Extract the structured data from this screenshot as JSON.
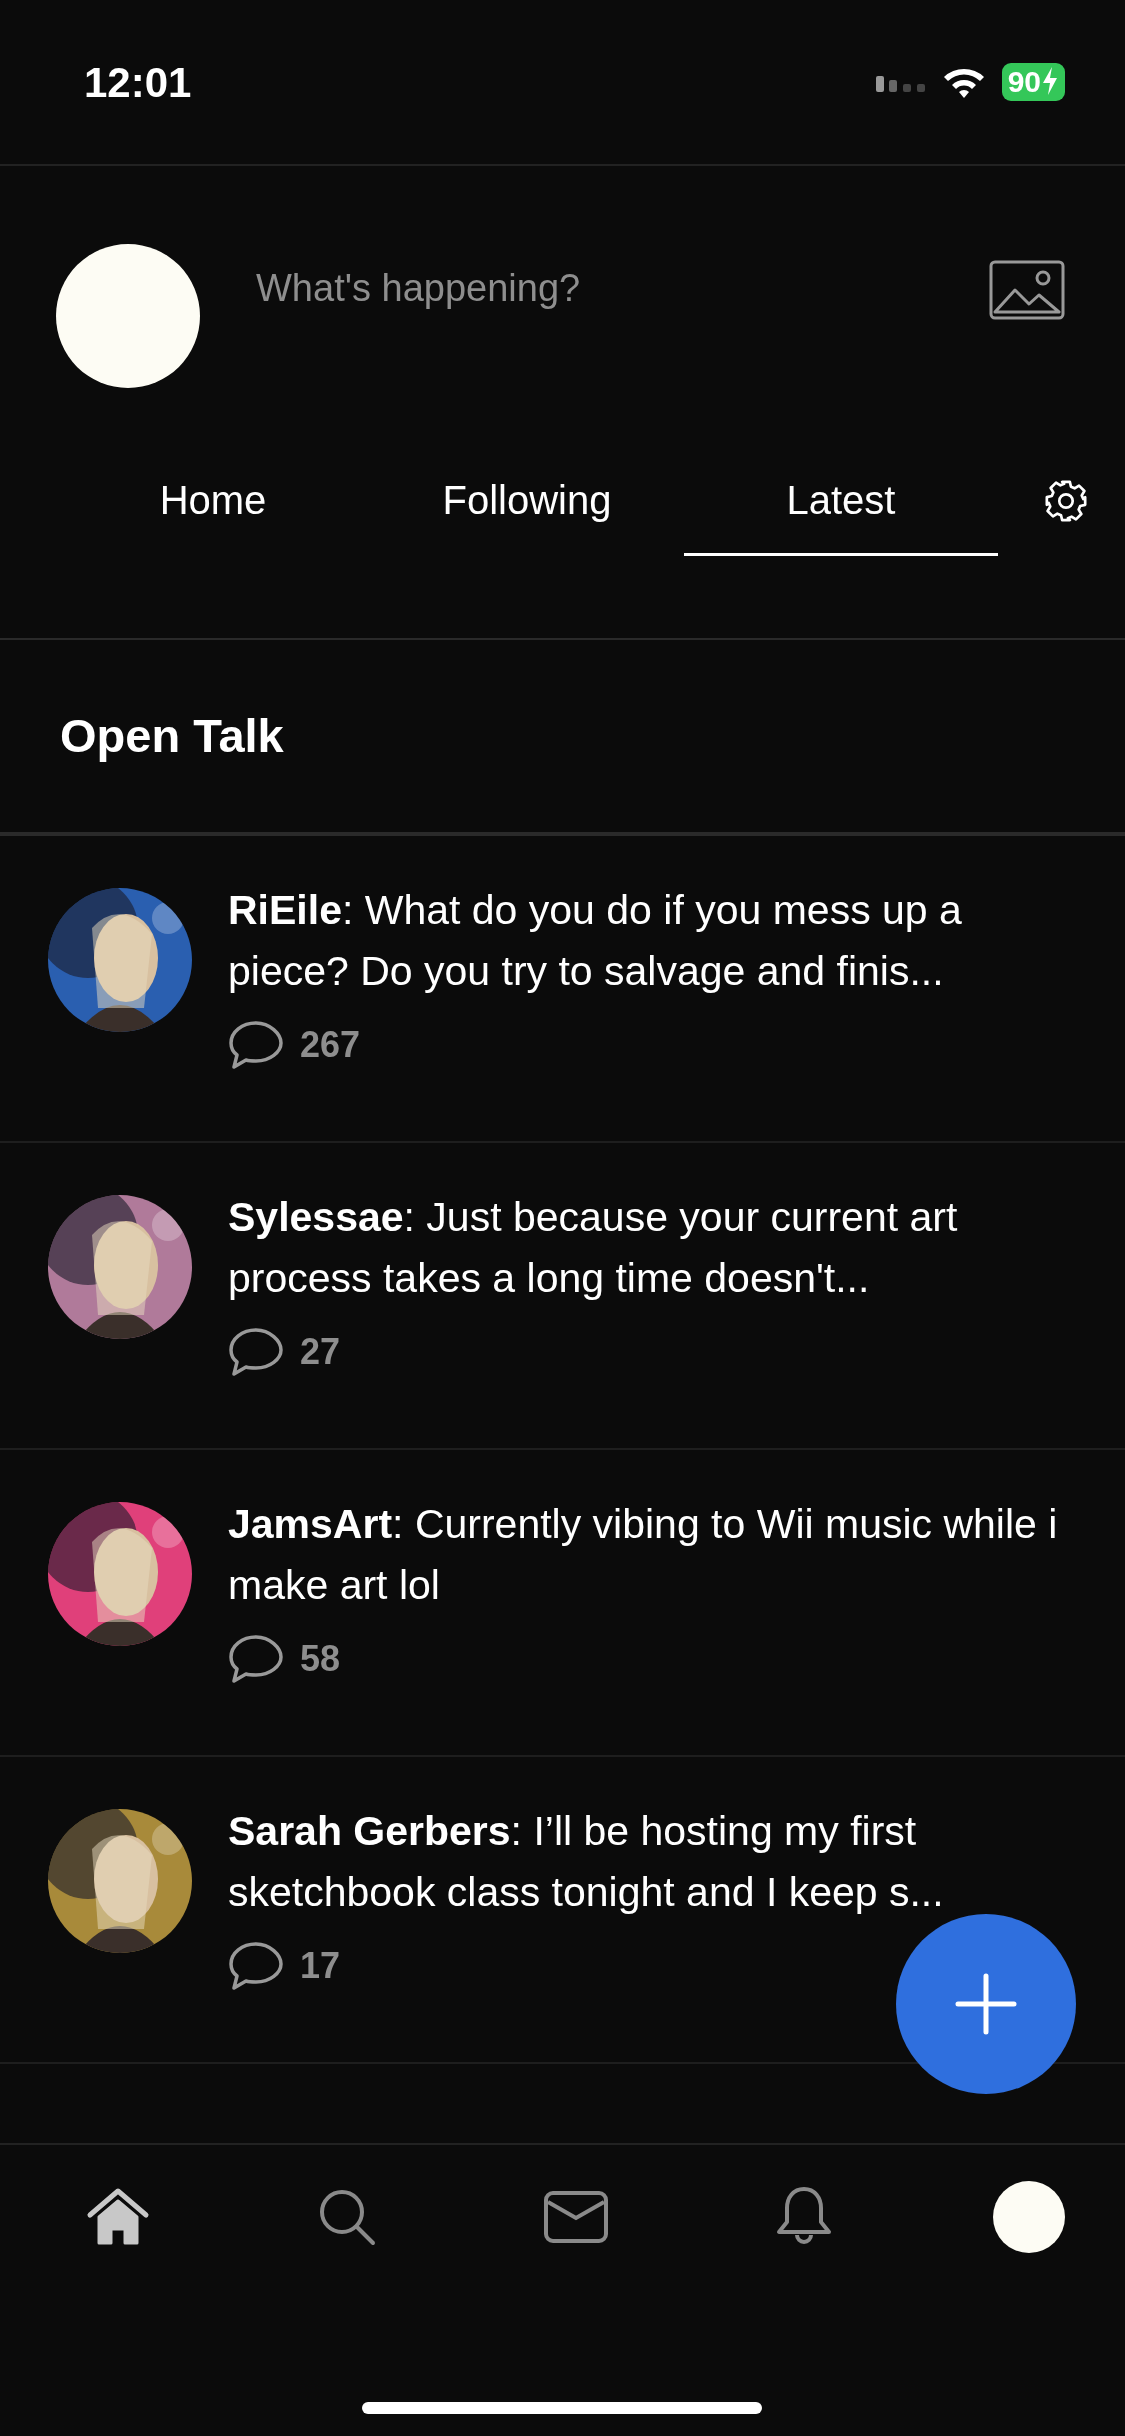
{
  "status_bar": {
    "time": "12:01",
    "battery": "90"
  },
  "composer": {
    "placeholder": "What's happening?"
  },
  "tabs": [
    {
      "label": "Home",
      "selected": false
    },
    {
      "label": "Following",
      "selected": false
    },
    {
      "label": "Latest",
      "selected": true
    }
  ],
  "section": {
    "title": "Open Talk"
  },
  "posts": [
    {
      "text": "**RiEile**: What do you do if you mess up a piece? Do you try to salvage and finis...",
      "comments": "267"
    },
    {
      "text": "**Sylessae**: Just because your current art process takes a long time doesn't...",
      "comments": "27"
    },
    {
      "text": "**JamsArt**: Currently vibing to Wii music while i make art lol",
      "comments": "58"
    },
    {
      "text": "**Sarah Gerbers**: I’ll be hosting my first sketchbook class tonight and I keep s...",
      "comments": "17"
    }
  ],
  "bottom_nav": [
    {
      "kind": "home",
      "selected": true
    },
    {
      "kind": "search",
      "selected": false
    },
    {
      "kind": "mail",
      "selected": false
    },
    {
      "kind": "bell",
      "selected": false
    },
    {
      "kind": "avatar",
      "selected": false
    }
  ]
}
